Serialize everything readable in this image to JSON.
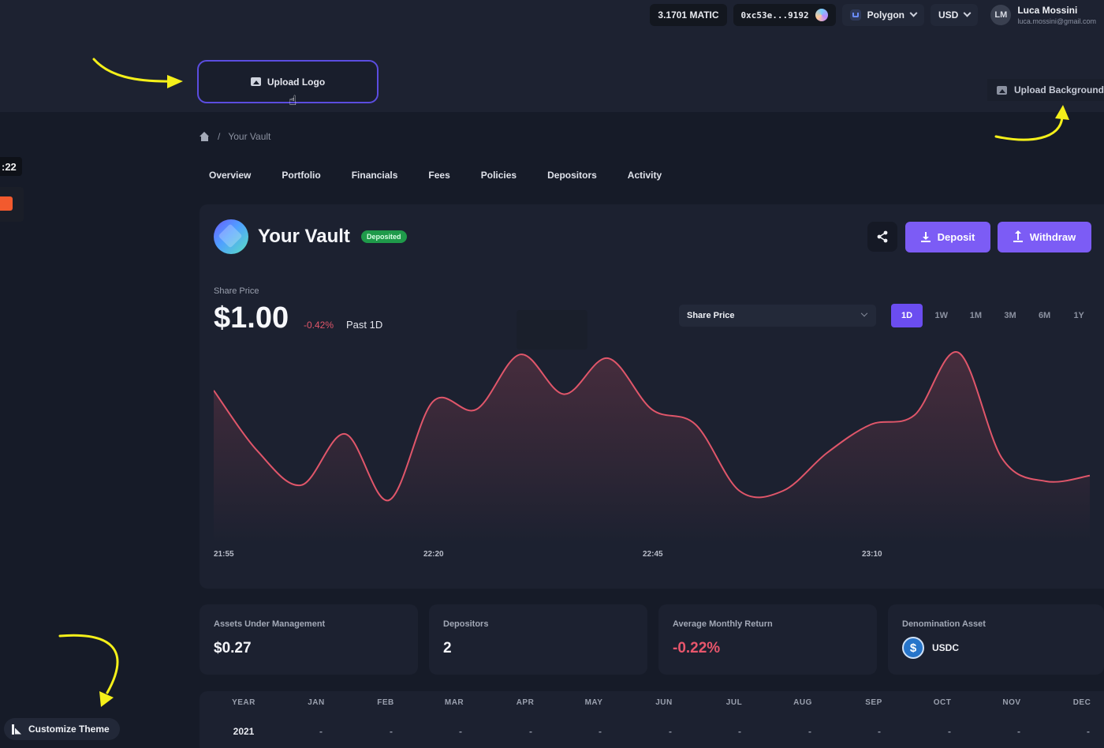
{
  "topbar": {
    "balance": "3.1701 MATIC",
    "address": "0xc53e...9192",
    "network": "Polygon",
    "currency": "USD",
    "user": {
      "initials": "LM",
      "name": "Luca Mossini",
      "email": "luca.mossini@gmail.com"
    }
  },
  "uploads": {
    "logo_label": "Upload Logo",
    "background_label": "Upload Background"
  },
  "side": {
    "timer": ":22"
  },
  "breadcrumb": {
    "home": "home-icon",
    "separator": "/",
    "current": "Your Vault"
  },
  "tabs": [
    "Overview",
    "Portfolio",
    "Financials",
    "Fees",
    "Policies",
    "Depositors",
    "Activity"
  ],
  "vault": {
    "title": "Your Vault",
    "badge": "Deposited",
    "deposit_label": "Deposit",
    "withdraw_label": "Withdraw"
  },
  "share_price": {
    "label": "Share Price",
    "value": "$1.00",
    "change": "-0.42%",
    "period": "Past 1D",
    "metric_selected": "Share Price",
    "ranges": [
      "1D",
      "1W",
      "1M",
      "3M",
      "6M",
      "1Y"
    ],
    "active_range": "1D"
  },
  "chart_data": {
    "type": "area",
    "x_ticks": [
      "21:55",
      "22:20",
      "22:45",
      "23:10"
    ],
    "series": [
      {
        "values": [
          0.78,
          0.46,
          0.28,
          0.55,
          0.2,
          0.72,
          0.68,
          0.97,
          0.76,
          0.95,
          0.68,
          0.6,
          0.25,
          0.25,
          0.45,
          0.6,
          0.65,
          0.98,
          0.42,
          0.3,
          0.33
        ]
      }
    ],
    "line_color": "#e0566a",
    "grid": false
  },
  "stats": [
    {
      "label": "Assets Under Management",
      "value": "$0.27"
    },
    {
      "label": "Depositors",
      "value": "2"
    },
    {
      "label": "Average Monthly Return",
      "value": "-0.22%"
    },
    {
      "label": "Denomination Asset",
      "value": "USDC"
    }
  ],
  "returns_table": {
    "headers": [
      "YEAR",
      "JAN",
      "FEB",
      "MAR",
      "APR",
      "MAY",
      "JUN",
      "JUL",
      "AUG",
      "SEP",
      "OCT",
      "NOV",
      "DEC"
    ],
    "rows": [
      [
        "2021",
        "-",
        "-",
        "-",
        "-",
        "-",
        "-",
        "-",
        "-",
        "-",
        "-",
        "-",
        "-"
      ]
    ]
  },
  "customize_label": "Customize Theme",
  "colors": {
    "accent": "#7c5cf5",
    "negative": "#e0566a",
    "positive_badge": "#1f9a4a",
    "annotation": "#f5f01a"
  }
}
